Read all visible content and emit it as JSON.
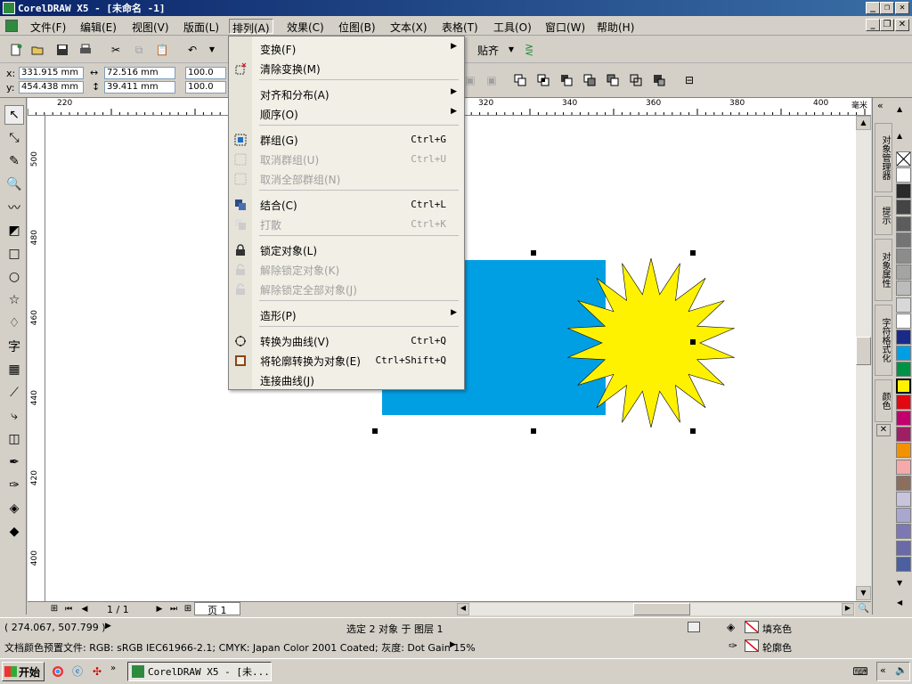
{
  "window": {
    "title": "CorelDRAW X5 - [未命名 -1]"
  },
  "menubar": {
    "items": [
      "文件(F)",
      "编辑(E)",
      "视图(V)",
      "版面(L)",
      "排列(A)",
      "效果(C)",
      "位图(B)",
      "文本(X)",
      "表格(T)",
      "工具(O)",
      "窗口(W)",
      "帮助(H)"
    ]
  },
  "toolbar": {
    "snap_label": "贴齐"
  },
  "propbar": {
    "x_label": "x:",
    "x_value": "331.915 mm",
    "y_label": "y:",
    "y_value": "454.438 mm",
    "w_value": "72.516 mm",
    "h_value": "39.411 mm",
    "scale_x": "100.0",
    "scale_y": "100.0"
  },
  "hruler": {
    "ticks": [
      "220",
      "320",
      "340",
      "360",
      "380",
      "400"
    ],
    "unit": "毫米"
  },
  "vruler": {
    "ticks": [
      "500",
      "480",
      "460",
      "440",
      "420",
      "400"
    ]
  },
  "arrange_menu": {
    "items": [
      {
        "label": "变换(F)",
        "shortcut": "",
        "submenu": true,
        "disabled": false
      },
      {
        "label": "清除变换(M)",
        "shortcut": "",
        "submenu": false,
        "disabled": false
      },
      {
        "label": "对齐和分布(A)",
        "shortcut": "",
        "submenu": true,
        "disabled": false
      },
      {
        "label": "顺序(O)",
        "shortcut": "",
        "submenu": true,
        "disabled": false
      },
      {
        "label": "群组(G)",
        "shortcut": "Ctrl+G",
        "submenu": false,
        "disabled": false
      },
      {
        "label": "取消群组(U)",
        "shortcut": "Ctrl+U",
        "submenu": false,
        "disabled": true
      },
      {
        "label": "取消全部群组(N)",
        "shortcut": "",
        "submenu": false,
        "disabled": true
      },
      {
        "label": "结合(C)",
        "shortcut": "Ctrl+L",
        "submenu": false,
        "disabled": false
      },
      {
        "label": "打散",
        "shortcut": "Ctrl+K",
        "submenu": false,
        "disabled": true
      },
      {
        "label": "锁定对象(L)",
        "shortcut": "",
        "submenu": false,
        "disabled": false
      },
      {
        "label": "解除锁定对象(K)",
        "shortcut": "",
        "submenu": false,
        "disabled": true
      },
      {
        "label": "解除锁定全部对象(J)",
        "shortcut": "",
        "submenu": false,
        "disabled": true
      },
      {
        "label": "造形(P)",
        "shortcut": "",
        "submenu": true,
        "disabled": false
      },
      {
        "label": "转换为曲线(V)",
        "shortcut": "Ctrl+Q",
        "submenu": false,
        "disabled": false
      },
      {
        "label": "将轮廓转换为对象(E)",
        "shortcut": "Ctrl+Shift+Q",
        "submenu": false,
        "disabled": false
      },
      {
        "label": "连接曲线(J)",
        "shortcut": "",
        "submenu": false,
        "disabled": false
      }
    ]
  },
  "dockers": {
    "tabs": [
      "对象管理器",
      "提示",
      "对象属性",
      "字符格式化",
      "颜色"
    ]
  },
  "page_nav": {
    "page_count": "1 / 1",
    "page_tab": "页 1"
  },
  "status": {
    "cursor": "( 274.067, 507.799 )",
    "selection": "选定 2 对象 于 图层 1",
    "fill_label": "填充色",
    "outline_label": "轮廓色",
    "color_profile": "文档颜色预置文件: RGB: sRGB IEC61966-2.1; CMYK: Japan Color 2001 Coated; 灰度: Dot Gain 15%"
  },
  "taskbar": {
    "start": "开始",
    "task": "CorelDRAW X5 - [未..."
  },
  "colors": {
    "rect_fill": "#009fe3",
    "star_fill": "#fff200",
    "palette": [
      "#ffffff",
      "#2a2a2a",
      "#444444",
      "#5c5c5c",
      "#747474",
      "#8c8c8c",
      "#a4a4a4",
      "#bcbcbc",
      "#d8d8d8",
      "#ffffff",
      "#1a2a8a",
      "#009fe3",
      "#009245",
      "#fff200",
      "#e30613",
      "#c2006e",
      "#9e1f63",
      "#f39200",
      "#f5a9a9",
      "#8b6f5c",
      "#c9c3dc",
      "#a9a6cf",
      "#7d78b5",
      "#6a6aa8",
      "#4c5fa0"
    ]
  }
}
